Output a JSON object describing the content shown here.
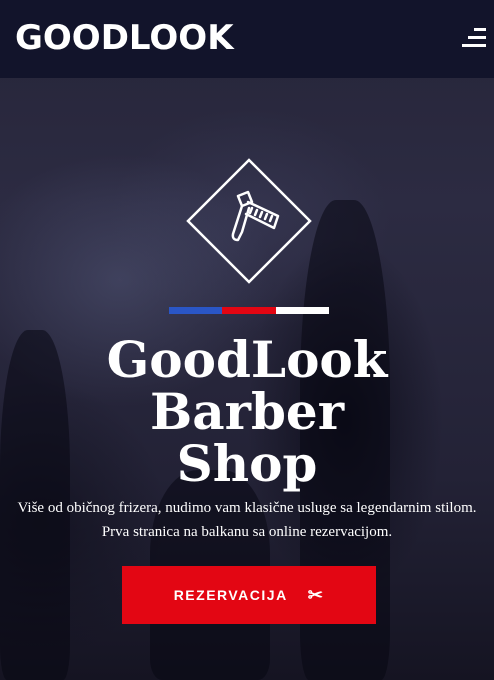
{
  "header": {
    "logo": "GOODLOOK",
    "menu_icon": "hamburger-menu-icon"
  },
  "hero": {
    "emblem_icon": "straight-razor-icon",
    "flag_colors": [
      "#2a56c6",
      "#e30613",
      "#ffffff"
    ],
    "title_lines": [
      "GoodLook",
      "Barber",
      "Shop"
    ],
    "subtitle_lines": [
      "Više od običnog frizera, nudimo vam klasične usluge sa legendarnim stilom.",
      "Prva stranica na balkanu sa online rezervacijom."
    ],
    "cta_label": "REZERVACIJA",
    "cta_icon": "scissors-icon",
    "cta_icon_glyph": "✂"
  },
  "colors": {
    "header_bg": "#12142b",
    "accent": "#e30613"
  }
}
